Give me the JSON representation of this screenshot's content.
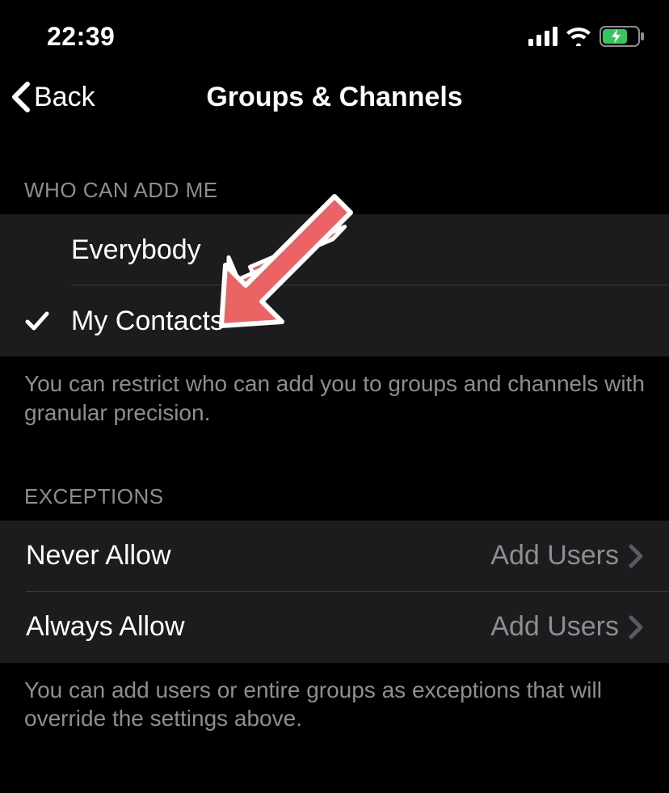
{
  "statusBar": {
    "time": "22:39"
  },
  "nav": {
    "backLabel": "Back",
    "title": "Groups & Channels"
  },
  "sections": {
    "whoCanAdd": {
      "header": "WHO CAN ADD ME",
      "options": [
        {
          "label": "Everybody",
          "selected": false
        },
        {
          "label": "My Contacts",
          "selected": true
        }
      ],
      "footer": "You can restrict who can add you to groups and channels with granular precision."
    },
    "exceptions": {
      "header": "EXCEPTIONS",
      "rows": [
        {
          "label": "Never Allow",
          "value": "Add Users"
        },
        {
          "label": "Always Allow",
          "value": "Add Users"
        }
      ],
      "footer": "You can add users or entire groups as exceptions that will override the settings above."
    }
  }
}
